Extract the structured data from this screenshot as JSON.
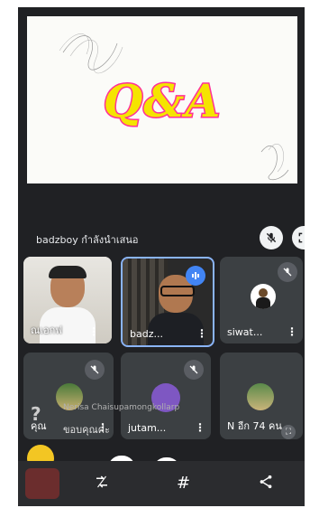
{
  "slide": {
    "title": "Q&A"
  },
  "presenter": {
    "text": "badzboy กำลังนำเสนอ"
  },
  "tiles": [
    {
      "name": "ณเอกฟ"
    },
    {
      "name": "badz..."
    },
    {
      "name": "siwat..."
    },
    {
      "name": "คุณ"
    },
    {
      "name": "jutam..."
    },
    {
      "name": "N อีก 74 คน"
    }
  ],
  "overlay": {
    "caption_name": "Nerisa Chaisupamongkollarp",
    "caption_text": "ขอบคุณค่ะ"
  },
  "icons": {
    "mic_off": "mic-off-icon",
    "fullscreen": "fullscreen-icon",
    "audio": "speaking-icon",
    "more": "more-vert-icon",
    "bottom": [
      "flip-camera-icon",
      "hashtag-icon",
      "share-icon"
    ]
  },
  "colors": {
    "title_fill": "#f5e400",
    "title_stroke": "#ff2f98",
    "speaking": "#8ab4f8"
  }
}
